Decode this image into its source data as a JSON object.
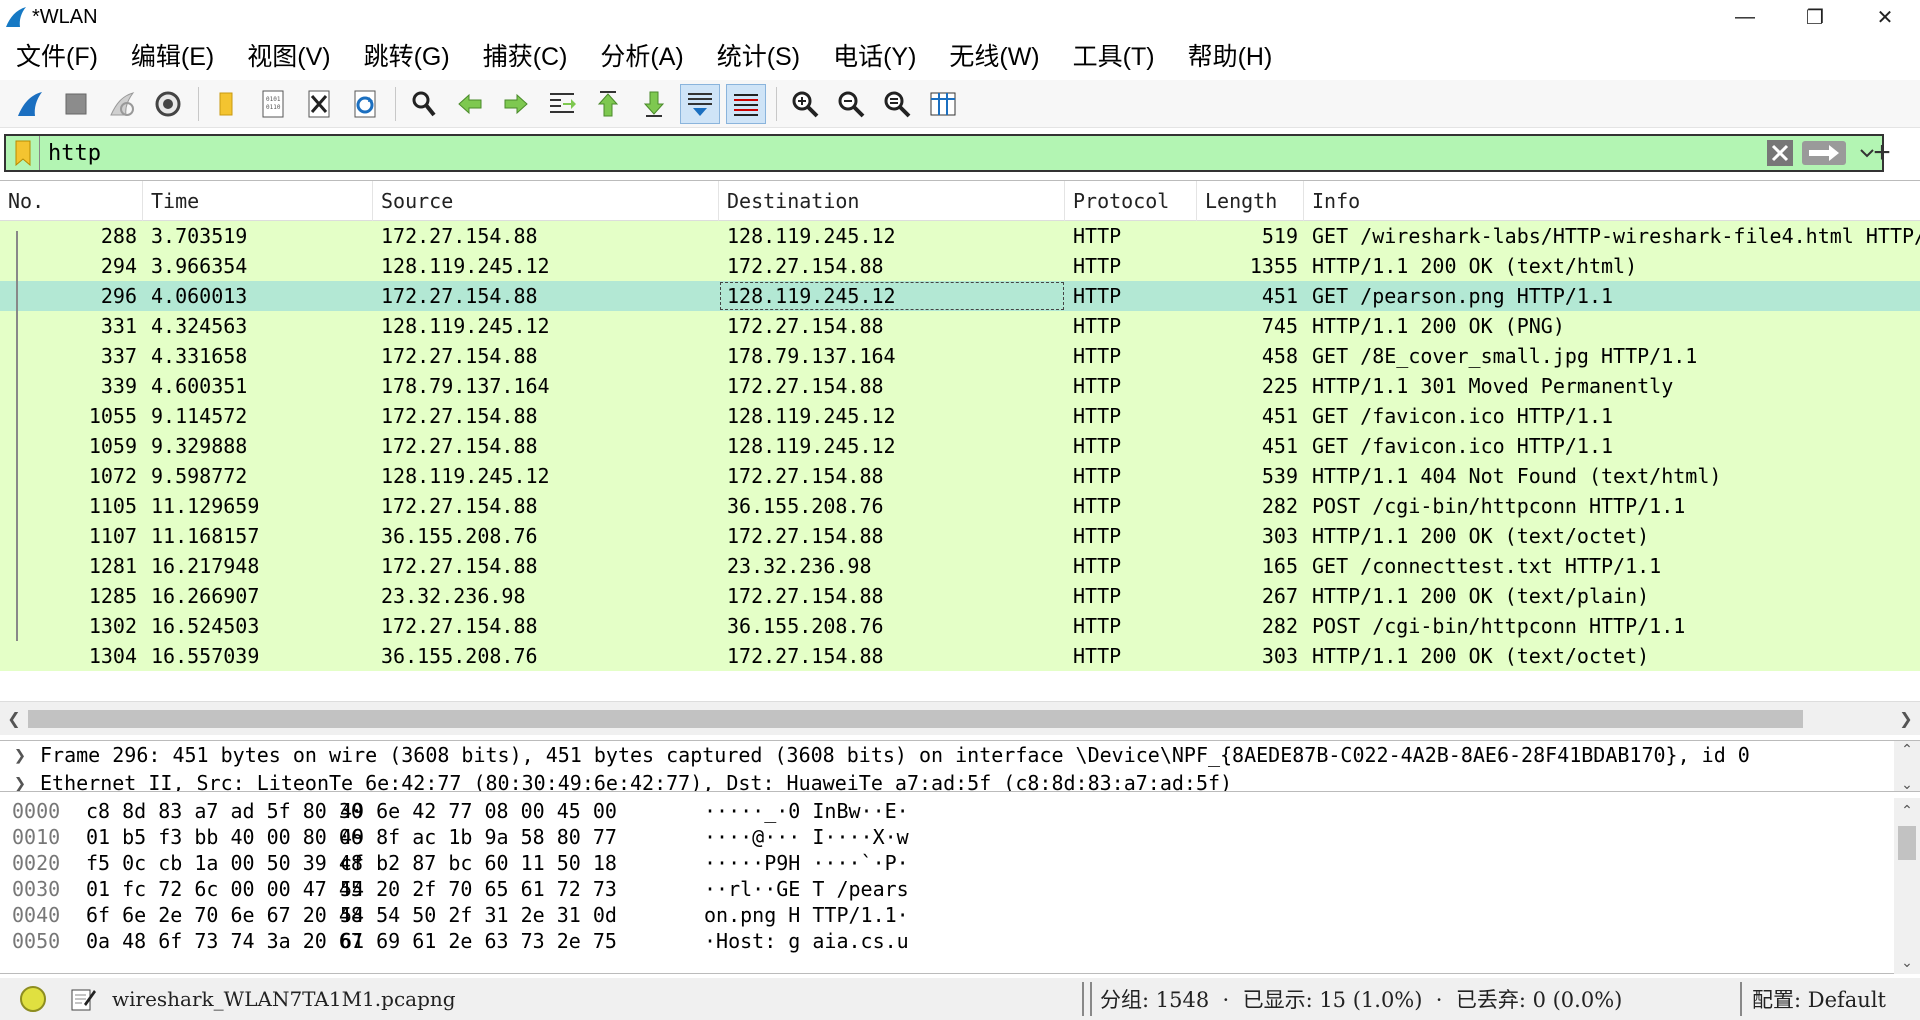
{
  "window": {
    "title": "*WLAN",
    "minimize_glyph": "—",
    "restore_glyph": "❐",
    "close_glyph": "✕"
  },
  "menu": [
    "文件(F)",
    "编辑(E)",
    "视图(V)",
    "跳转(G)",
    "捕获(C)",
    "分析(A)",
    "统计(S)",
    "电话(Y)",
    "无线(W)",
    "工具(T)",
    "帮助(H)"
  ],
  "toolbar": {
    "icons": [
      "shark-fin-start-icon",
      "stop-capture-icon",
      "restart-capture-icon",
      "capture-options-icon",
      "open-file-icon",
      "save-file-icon",
      "close-file-icon",
      "reload-file-icon",
      "find-packet-icon",
      "go-back-icon",
      "go-forward-icon",
      "go-to-packet-icon",
      "first-packet-icon",
      "last-packet-icon",
      "autoscroll-icon",
      "colorize-icon",
      "zoom-in-icon",
      "zoom-out-icon",
      "zoom-normal-icon",
      "resize-columns-icon"
    ]
  },
  "filter": {
    "value": "http",
    "add_glyph": "+"
  },
  "packet_list": {
    "columns": [
      "No.",
      "Time",
      "Source",
      "Destination",
      "Protocol",
      "Length",
      "Info"
    ],
    "rows": [
      {
        "no": "288",
        "time": "3.703519",
        "src": "172.27.154.88",
        "dst": "128.119.245.12",
        "proto": "HTTP",
        "len": "519",
        "info": "GET /wireshark-labs/HTTP-wireshark-file4.html HTTP/"
      },
      {
        "no": "294",
        "time": "3.966354",
        "src": "128.119.245.12",
        "dst": "172.27.154.88",
        "proto": "HTTP",
        "len": "1355",
        "info": "HTTP/1.1 200 OK  (text/html)"
      },
      {
        "no": "296",
        "time": "4.060013",
        "src": "172.27.154.88",
        "dst": "128.119.245.12",
        "proto": "HTTP",
        "len": "451",
        "info": "GET /pearson.png HTTP/1.1",
        "selected": true
      },
      {
        "no": "331",
        "time": "4.324563",
        "src": "128.119.245.12",
        "dst": "172.27.154.88",
        "proto": "HTTP",
        "len": "745",
        "info": "HTTP/1.1 200 OK  (PNG)"
      },
      {
        "no": "337",
        "time": "4.331658",
        "src": "172.27.154.88",
        "dst": "178.79.137.164",
        "proto": "HTTP",
        "len": "458",
        "info": "GET /8E_cover_small.jpg HTTP/1.1"
      },
      {
        "no": "339",
        "time": "4.600351",
        "src": "178.79.137.164",
        "dst": "172.27.154.88",
        "proto": "HTTP",
        "len": "225",
        "info": "HTTP/1.1 301 Moved Permanently"
      },
      {
        "no": "1055",
        "time": "9.114572",
        "src": "172.27.154.88",
        "dst": "128.119.245.12",
        "proto": "HTTP",
        "len": "451",
        "info": "GET /favicon.ico HTTP/1.1"
      },
      {
        "no": "1059",
        "time": "9.329888",
        "src": "172.27.154.88",
        "dst": "128.119.245.12",
        "proto": "HTTP",
        "len": "451",
        "info": "GET /favicon.ico HTTP/1.1"
      },
      {
        "no": "1072",
        "time": "9.598772",
        "src": "128.119.245.12",
        "dst": "172.27.154.88",
        "proto": "HTTP",
        "len": "539",
        "info": "HTTP/1.1 404 Not Found  (text/html)"
      },
      {
        "no": "1105",
        "time": "11.129659",
        "src": "172.27.154.88",
        "dst": "36.155.208.76",
        "proto": "HTTP",
        "len": "282",
        "info": "POST /cgi-bin/httpconn HTTP/1.1"
      },
      {
        "no": "1107",
        "time": "11.168157",
        "src": "36.155.208.76",
        "dst": "172.27.154.88",
        "proto": "HTTP",
        "len": "303",
        "info": "HTTP/1.1 200 OK  (text/octet)"
      },
      {
        "no": "1281",
        "time": "16.217948",
        "src": "172.27.154.88",
        "dst": "23.32.236.98",
        "proto": "HTTP",
        "len": "165",
        "info": "GET /connecttest.txt HTTP/1.1"
      },
      {
        "no": "1285",
        "time": "16.266907",
        "src": "23.32.236.98",
        "dst": "172.27.154.88",
        "proto": "HTTP",
        "len": "267",
        "info": "HTTP/1.1 200 OK  (text/plain)"
      },
      {
        "no": "1302",
        "time": "16.524503",
        "src": "172.27.154.88",
        "dst": "36.155.208.76",
        "proto": "HTTP",
        "len": "282",
        "info": "POST /cgi-bin/httpconn HTTP/1.1"
      },
      {
        "no": "1304",
        "time": "16.557039",
        "src": "36.155.208.76",
        "dst": "172.27.154.88",
        "proto": "HTTP",
        "len": "303",
        "info": "HTTP/1.1 200 OK  (text/octet)"
      }
    ]
  },
  "details": {
    "lines": [
      "Frame 296: 451 bytes on wire (3608 bits), 451 bytes captured (3608 bits) on interface \\Device\\NPF_{8AEDE87B-C022-4A2B-8AE6-28F41BDAB170}, id 0",
      "Ethernet II, Src: LiteonTe_6e:42:77 (80:30:49:6e:42:77), Dst: HuaweiTe_a7:ad:5f (c8:8d:83:a7:ad:5f)"
    ]
  },
  "bytes": [
    {
      "off": "0000",
      "hex1": "c8 8d 83 a7 ad 5f 80 30",
      "hex2": "49 6e 42 77 08 00 45 00",
      "ascii": "·····_·0 InBw··E·"
    },
    {
      "off": "0010",
      "hex1": "01 b5 f3 bb 40 00 80 06",
      "hex2": "49 8f ac 1b 9a 58 80 77",
      "ascii": "····@··· I····X·w"
    },
    {
      "off": "0020",
      "hex1": "f5 0c cb 1a 00 50 39 48",
      "hex2": "cf b2 87 bc 60 11 50 18",
      "ascii": "·····P9H ····`·P·"
    },
    {
      "off": "0030",
      "hex1": "01 fc 72 6c 00 00 47 45",
      "hex2": "54 20 2f 70 65 61 72 73",
      "ascii": "··rl··GE T /pears"
    },
    {
      "off": "0040",
      "hex1": "6f 6e 2e 70 6e 67 20 48",
      "hex2": "54 54 50 2f 31 2e 31 0d",
      "ascii": "on.png H TTP/1.1·"
    },
    {
      "off": "0050",
      "hex1": "0a 48 6f 73 74 3a 20 67",
      "hex2": "61 69 61 2e 63 73 2e 75",
      "ascii": "·Host: g aia.cs.u"
    }
  ],
  "status": {
    "file": "wireshark_WLAN7TA1M1.pcapng",
    "stats": "分组: 1548  ·  已显示: 15 (1.0%)  ·  已丢弃: 0 (0.0%)",
    "profile": "配置: Default"
  }
}
